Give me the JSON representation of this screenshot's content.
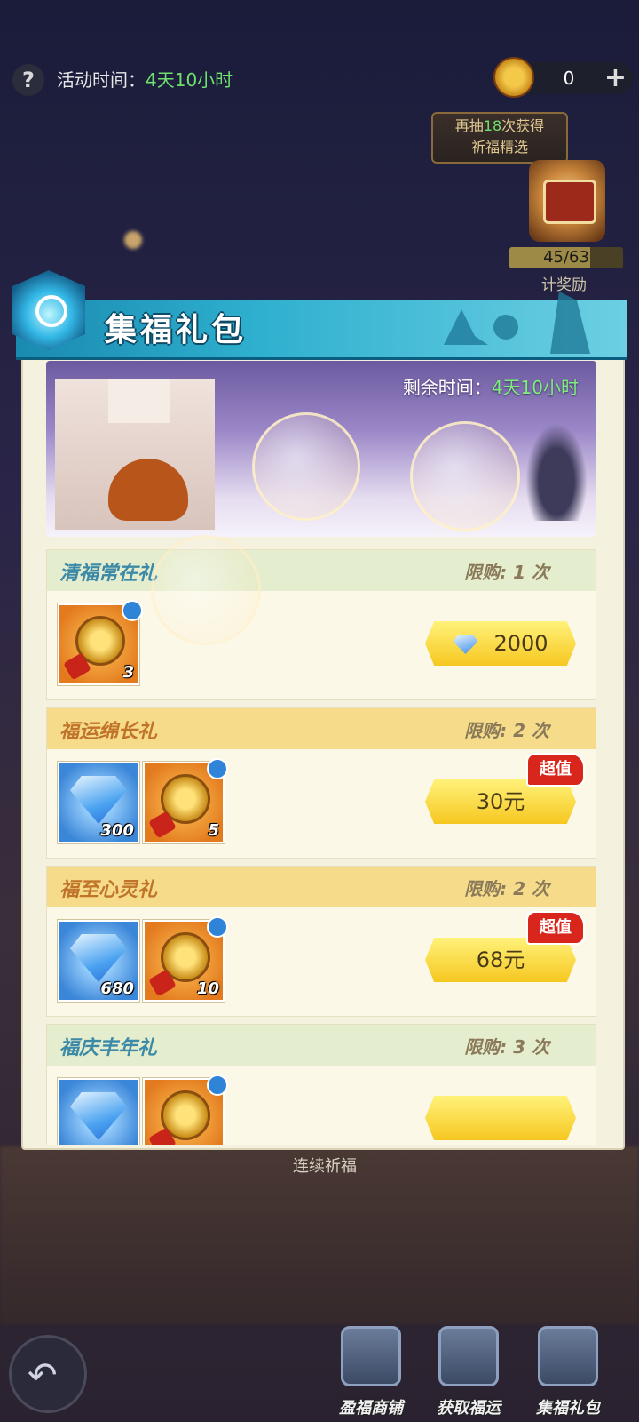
{
  "topbar": {
    "help_symbol": "?",
    "activity_label": "活动时间：",
    "activity_value": "4天10小时",
    "coin_count": "0",
    "plus_symbol": "+"
  },
  "draw_tip": {
    "prefix": "再抽",
    "count": "18",
    "suffix": "次获得",
    "line2": "祈福精选"
  },
  "accumulate": {
    "progress_text": "45/63",
    "progress_value": 45,
    "progress_max": 63,
    "label": "计奖励"
  },
  "panel": {
    "title": "集福礼包",
    "remain_label": "剩余时间：",
    "remain_value": "4天10小时"
  },
  "packs": [
    {
      "title": "清福常在礼",
      "limit": "限购: 1 次",
      "style": "green",
      "items": [
        {
          "kind": "coin",
          "qty": "3"
        }
      ],
      "price": "2000",
      "price_type": "gem",
      "badge": ""
    },
    {
      "title": "福运绵长礼",
      "limit": "限购: 2 次",
      "style": "gold",
      "items": [
        {
          "kind": "gem",
          "qty": "300"
        },
        {
          "kind": "coin",
          "qty": "5"
        }
      ],
      "price": "30元",
      "price_type": "cash",
      "badge": "超值"
    },
    {
      "title": "福至心灵礼",
      "limit": "限购: 2 次",
      "style": "gold",
      "items": [
        {
          "kind": "gem",
          "qty": "680"
        },
        {
          "kind": "coin",
          "qty": "10"
        }
      ],
      "price": "68元",
      "price_type": "cash",
      "badge": "超值"
    },
    {
      "title": "福庆丰年礼",
      "limit": "限购: 3 次",
      "style": "green",
      "items": [
        {
          "kind": "gem",
          "qty": ""
        },
        {
          "kind": "coin",
          "qty": ""
        }
      ],
      "price": "",
      "price_type": "cash",
      "badge": ""
    }
  ],
  "under_label": "连续祈福",
  "tabs": [
    {
      "label": "盈福商铺"
    },
    {
      "label": "获取福运"
    },
    {
      "label": "集福礼包"
    }
  ]
}
